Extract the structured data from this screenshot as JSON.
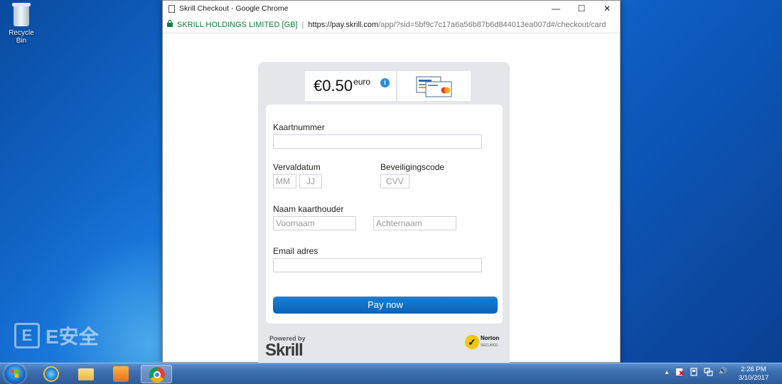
{
  "desktop": {
    "recycle_bin_label": "Recycle Bin",
    "watermark_text": "E安全"
  },
  "browser": {
    "window_title": "Skrill Checkout - Google Chrome",
    "controls": {
      "minimize": "—",
      "maximize": "☐",
      "close": "✕"
    },
    "address": {
      "lock_icon": "lock-icon",
      "org": "SKRILL HOLDINGS LIMITED [GB]",
      "separator": "|",
      "url_main": "https://pay.skrill.com",
      "url_rest": "/app/?sid=5bf9c7c17a6a56b87b6d844013ea007d#/checkout/card"
    }
  },
  "checkout": {
    "amount": "€0.50",
    "currency": "euro",
    "info_icon": "i",
    "card_number_label": "Kaartnummer",
    "card_number_value": "",
    "expiry_label": "Vervaldatum",
    "expiry_month_placeholder": "MM",
    "expiry_year_placeholder": "JJ",
    "security_label": "Beveiligingscode",
    "cvv_placeholder": "CVV",
    "holder_label": "Naam kaarthouder",
    "first_name_placeholder": "Voornaam",
    "last_name_placeholder": "Achternaam",
    "email_label": "Email adres",
    "email_value": "",
    "pay_button": "Pay now",
    "powered_by": "Powered by",
    "brand": "Skrill",
    "norton_check": "✓",
    "norton_name": "Norton",
    "norton_sub": "SECURED"
  },
  "taskbar": {
    "clock_time": "2:26 PM",
    "clock_date": "3/10/2017",
    "tray": {
      "up_arrow": "▲",
      "volume": "🔊"
    }
  },
  "colors": {
    "skrill_blue": "#0b63b6",
    "norton_yellow": "#f4c600",
    "secure_green": "#0b8043"
  }
}
